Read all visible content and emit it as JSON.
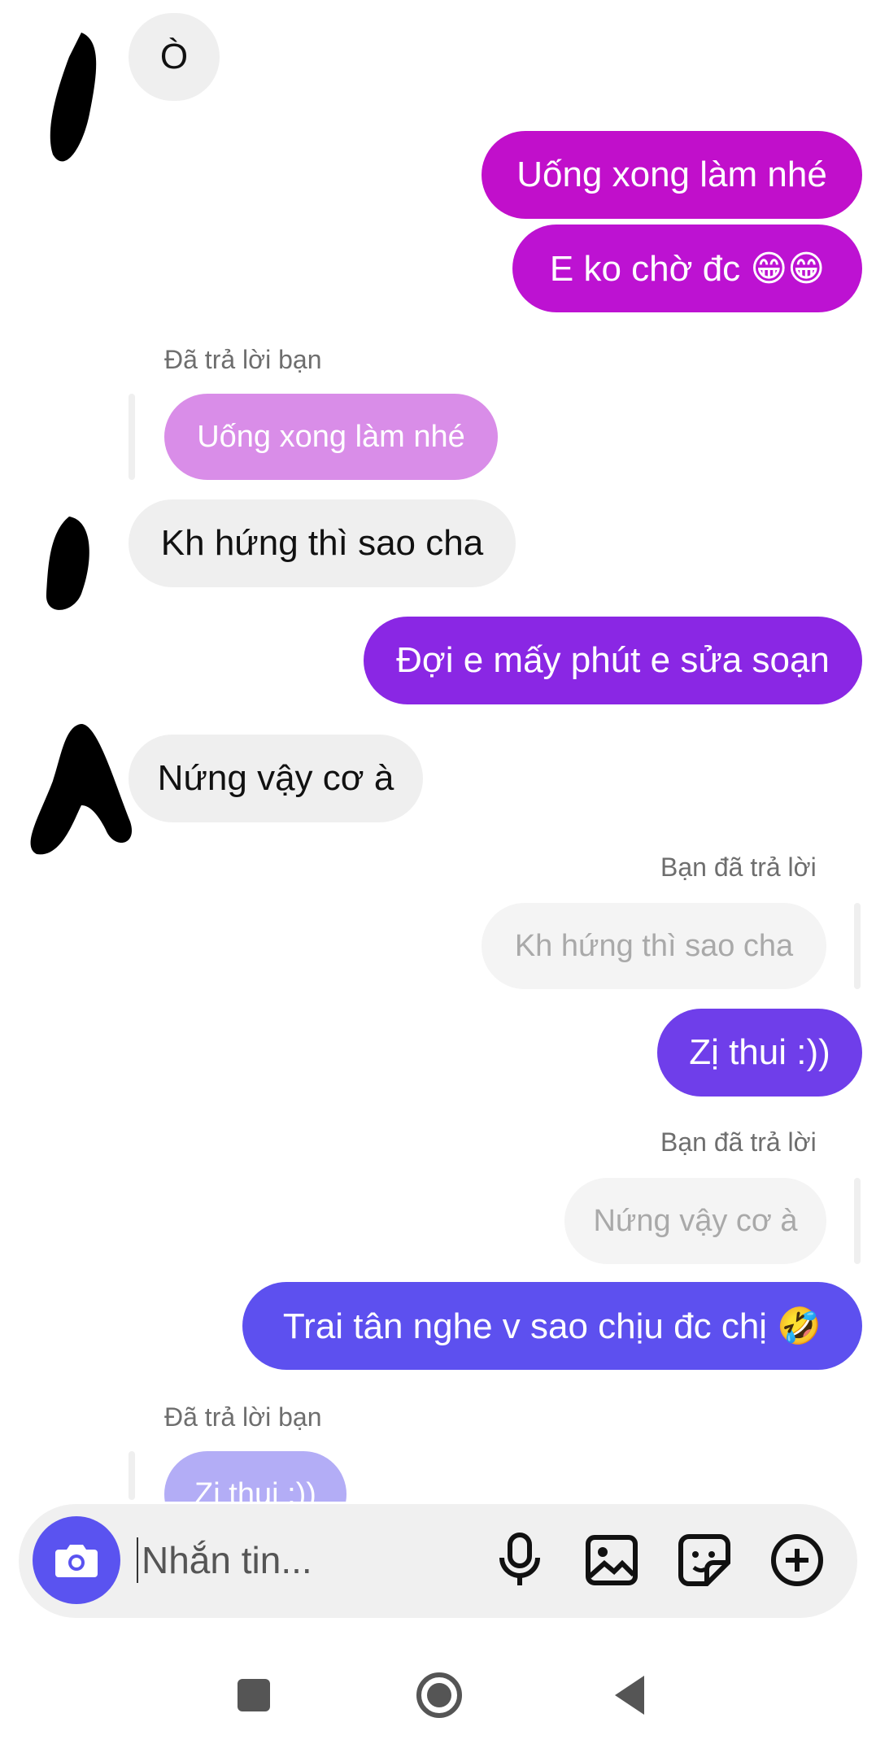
{
  "messages": {
    "m1": "Ò",
    "m2": "Uống xong làm nhé",
    "m3": "E ko chờ đc 😁😁",
    "reply_label_1": "Đã trả lời bạn",
    "quote_1": "Uống xong làm nhé",
    "m4": "Kh hứng thì sao cha",
    "m5": "Đợi e mấy phút e sửa soạn",
    "m6": "Nứng vậy cơ à",
    "reply_label_2": "Bạn đã trả lời",
    "quote_2": "Kh hứng thì sao cha",
    "m7": "Zị thui :))",
    "reply_label_3": "Bạn đã trả lời",
    "quote_3": "Nứng vậy cơ à",
    "m8": "Trai tân nghe v sao chịu đc chị 🤣",
    "reply_label_4": "Đã trả lời bạn",
    "quote_4": "Zị thui :))"
  },
  "composer": {
    "placeholder": "Nhắn tin..."
  },
  "colors": {
    "out_gradient_top": "#c20fcb",
    "out_gradient_mid": "#8a2be8",
    "out_gradient_bottom": "#5a53f0",
    "incoming_bubble": "#efefef",
    "camera_button": "#5a53f0"
  },
  "icons": [
    "camera-icon",
    "microphone-icon",
    "image-icon",
    "sticker-icon",
    "plus-icon",
    "nav-square-icon",
    "nav-home-icon",
    "nav-back-icon"
  ]
}
